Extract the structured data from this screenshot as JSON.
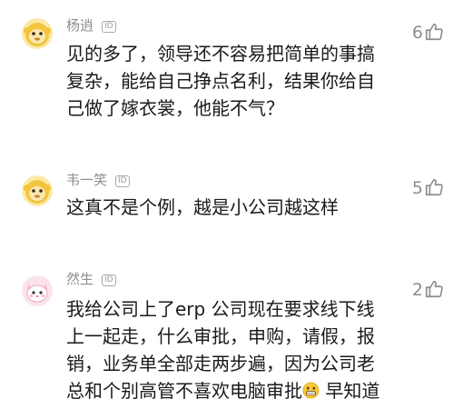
{
  "comments": [
    {
      "username": "杨逍",
      "id_badge": "ID",
      "lines": [
        "见的多了，领导还不容易把简单的事搞",
        "复杂，能给自己挣点名利，结果你给自",
        "己做了嫁衣裳，他能不气？"
      ],
      "likes": "6",
      "avatar_icon": "monkey-avatar-icon"
    },
    {
      "username": "韦一笑",
      "id_badge": "ID",
      "lines": [
        "这真不是个例，越是小公司越这样"
      ],
      "likes": "5",
      "avatar_icon": "monkey-avatar-icon"
    },
    {
      "username": "然生",
      "id_badge": "ID",
      "lines": [
        "我给公司上了erp 公司现在要求线下线",
        "上一起走，什么审批，申购，请假，报",
        "销，业务单全部走两步遍，因为公司老",
        "总和个别高管不喜欢电脑审批",
        "早知道"
      ],
      "likes": "2",
      "avatar_icon": "cat-avatar-icon",
      "inline_emoji": "grimace-emoji-icon"
    }
  ],
  "colors": {
    "text": "#1a1a1a",
    "meta": "#8d8d8d",
    "avatar_yellow": "#f7d44e",
    "avatar_pink": "#f7c6d2"
  }
}
